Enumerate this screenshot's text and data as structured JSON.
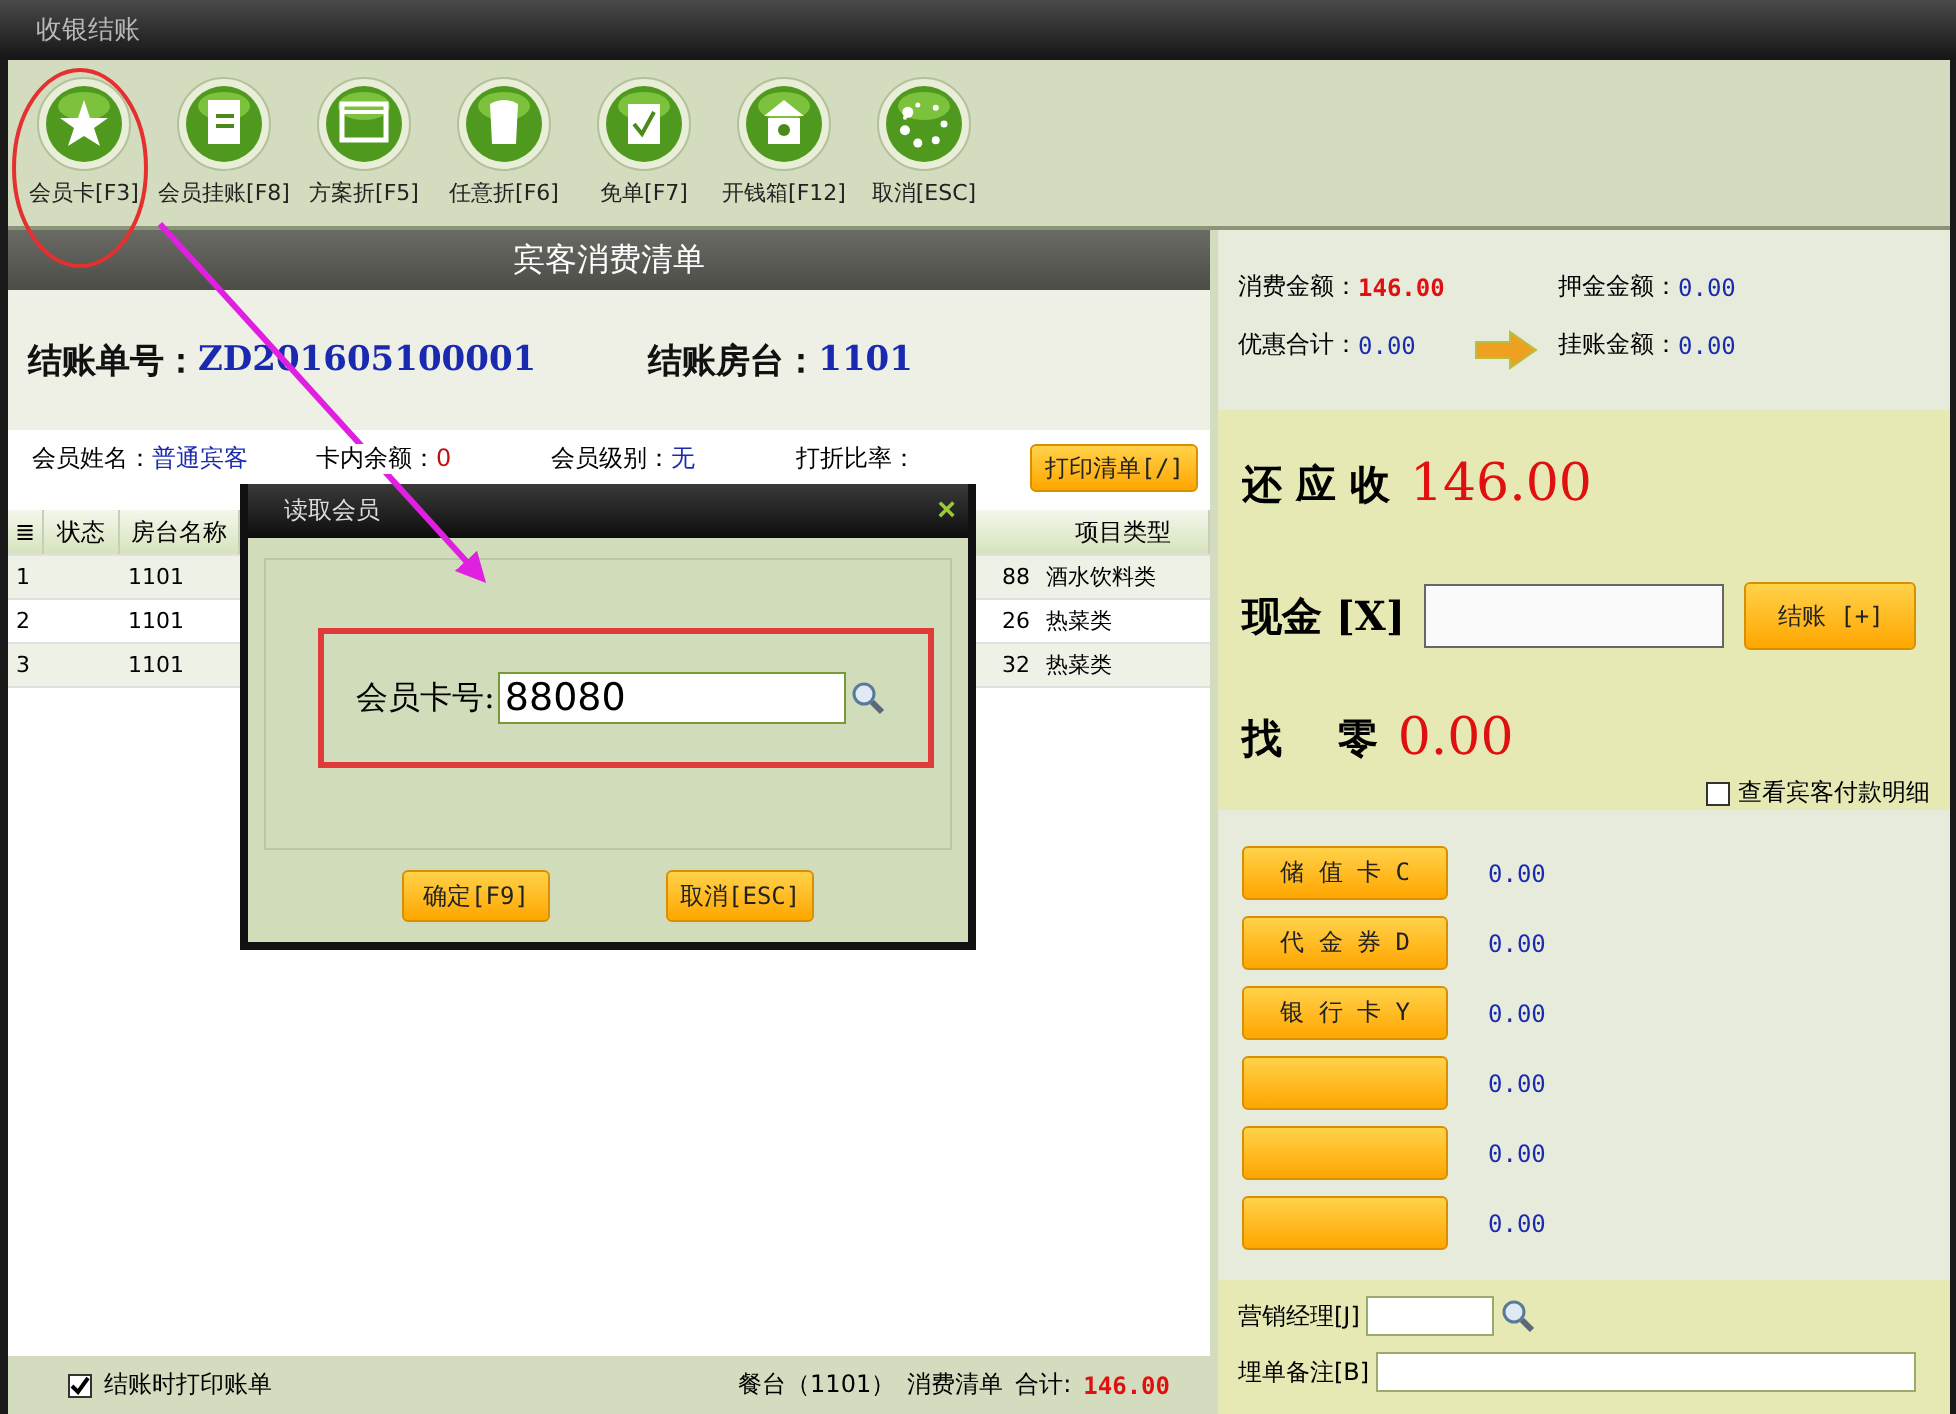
{
  "window": {
    "title": "收银结账"
  },
  "toolbar": [
    {
      "label": "会员卡[F3]",
      "kind": "vip"
    },
    {
      "label": "会员挂账[F8]",
      "kind": "document"
    },
    {
      "label": "方案折[F5]",
      "kind": "window"
    },
    {
      "label": "任意折[F6]",
      "kind": "bag"
    },
    {
      "label": "免单[F7]",
      "kind": "check"
    },
    {
      "label": "开钱箱[F12]",
      "kind": "building"
    },
    {
      "label": "取消[ESC]",
      "kind": "dots"
    }
  ],
  "bill": {
    "heading": "宾客消费清单",
    "bill_no_label": "结账单号：",
    "bill_no": "ZD201605100001",
    "room_label": "结账房台：",
    "room": "1101"
  },
  "member_info": [
    {
      "label": "会员姓名：",
      "value": "普通宾客",
      "color": "#1a2ab0"
    },
    {
      "label": "卡内余额：",
      "value": "0",
      "color": "#c01010"
    },
    {
      "label": "会员级别：",
      "value": "无",
      "color": "#1a2ab0"
    },
    {
      "label": "打折比率："
    }
  ],
  "print_list_button": "打印清单[/]",
  "table": {
    "columns": [
      "≣",
      "状态",
      "房台名称",
      "项目类型"
    ],
    "rows": [
      {
        "index": "1",
        "room": "1101",
        "column_4": "88",
        "category": "酒水饮料类"
      },
      {
        "index": "2",
        "room": "1101",
        "column_4": "26",
        "category": "热菜类"
      },
      {
        "index": "3",
        "room": "1101",
        "column_4": "32",
        "category": "热菜类"
      }
    ]
  },
  "footer": {
    "print_on_checkout": {
      "label": "结账时打印账单",
      "checked": true
    },
    "table_label": "餐台（1101）",
    "list_label": "消费清单",
    "total_label": "合计:",
    "total": "146.00"
  },
  "dialog": {
    "title": "读取会员",
    "close": "×",
    "field_label": "会员卡号:",
    "card_no": "88080",
    "buttons": [
      "确定[F9]",
      "取消[ESC]"
    ]
  },
  "summary": [
    {
      "label": "消费金额：",
      "value": "146.00",
      "color": "#e01010"
    },
    {
      "label": "押金金额：",
      "value": "0.00",
      "color": "#1a2ab0"
    },
    {
      "label": "优惠合计：",
      "value": "0.00",
      "color": "#1a2ab0"
    },
    {
      "label": "挂账金额：",
      "value": "0.00",
      "color": "#1a2ab0"
    }
  ],
  "due": {
    "label": "还 应 收",
    "value": "146.00"
  },
  "cash": {
    "label": "现金 [X]",
    "button": "结账 [+]"
  },
  "change": {
    "label": "找    零",
    "value": "0.00"
  },
  "show_payment_details": {
    "label": "查看宾客付款明细",
    "checked": false
  },
  "payments": [
    {
      "label": "储 值 卡 C",
      "amount": "0.00"
    },
    {
      "label": "代 金 券 D",
      "amount": "0.00"
    },
    {
      "label": "银 行 卡 Y",
      "amount": "0.00"
    },
    {
      "amount": "0.00"
    },
    {
      "amount": "0.00"
    },
    {
      "amount": "0.00"
    }
  ],
  "manager": {
    "label": "营销经理[J]"
  },
  "remark": {
    "label": "埋单备注[B]"
  }
}
